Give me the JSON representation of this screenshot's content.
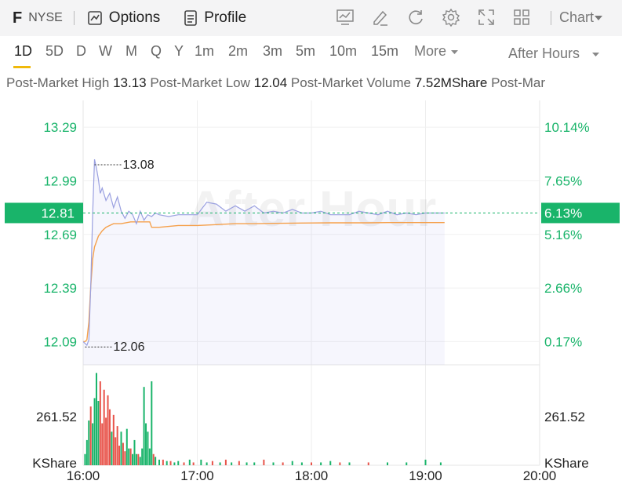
{
  "header": {
    "ticker": "F",
    "exchange": "NYSE",
    "options_label": "Options",
    "profile_label": "Profile",
    "chart_label": "Chart",
    "tools": [
      "analysis-chart-icon",
      "draw-pen-icon",
      "refresh-icon",
      "settings-icon",
      "fullscreen-icon",
      "layout-grid-icon"
    ]
  },
  "periods": [
    "1D",
    "5D",
    "D",
    "W",
    "M",
    "Q",
    "Y",
    "1m",
    "2m",
    "3m",
    "5m",
    "10m",
    "15m"
  ],
  "active_period": "1D",
  "more_label": "More",
  "session_label": "After Hours",
  "stats": [
    {
      "label": "Post-Market High",
      "value": "13.13"
    },
    {
      "label": "Post-Market Low",
      "value": "12.04"
    },
    {
      "label": "Post-Market Volume",
      "value": "7.52MShare"
    },
    {
      "label": "Post-Mar",
      "value": ""
    }
  ],
  "colors": {
    "up": "#19b46a",
    "down": "#e8534a",
    "price_line": "#9aa0e0",
    "avg_line": "#f5a04b",
    "current_tag": "#19b46a",
    "dashed": "#19b46a"
  },
  "chart_data": {
    "type": "line",
    "watermark": "After Hour",
    "y_ticks": [
      "13.29",
      "12.99",
      "12.69",
      "12.39",
      "12.09"
    ],
    "pct_ticks": [
      "10.14%",
      "7.65%",
      "5.16%",
      "2.66%",
      "0.17%"
    ],
    "current_price": "12.81",
    "current_pct": "6.13%",
    "high_annotation": "13.08",
    "low_annotation": "12.06",
    "x_ticks": [
      "16:00",
      "17:00",
      "18:00",
      "19:00",
      "20:00"
    ],
    "volume_tick": "261.52",
    "volume_unit": "KShare",
    "ylim": [
      11.96,
      13.44
    ],
    "x_range_minutes": [
      0,
      240
    ],
    "series": [
      {
        "x": [
          0,
          1,
          2,
          3,
          4,
          5,
          6,
          7,
          8,
          9,
          10,
          12,
          14,
          16,
          18,
          20,
          22,
          24,
          26,
          28,
          30,
          32,
          34,
          36,
          38,
          40,
          45,
          50,
          55,
          60,
          65,
          70,
          75,
          80,
          85,
          90,
          95,
          100,
          105,
          110,
          115,
          120,
          125,
          130,
          135,
          140,
          145,
          150,
          155,
          160,
          165,
          170,
          175,
          180,
          185,
          190
        ],
        "y": [
          12.09,
          12.08,
          12.07,
          12.1,
          12.4,
          12.8,
          13.11,
          13.06,
          13.0,
          12.92,
          12.95,
          12.88,
          12.92,
          12.84,
          12.9,
          12.82,
          12.78,
          12.82,
          12.8,
          12.75,
          12.82,
          12.77,
          12.8,
          12.79,
          12.81,
          12.8,
          12.79,
          12.8,
          12.8,
          12.8,
          12.87,
          12.86,
          12.82,
          12.85,
          12.82,
          12.85,
          12.81,
          12.82,
          12.81,
          12.83,
          12.81,
          12.81,
          12.82,
          12.8,
          12.8,
          12.8,
          12.82,
          12.81,
          12.8,
          12.82,
          12.8,
          12.81,
          12.8,
          12.81,
          12.81,
          12.81
        ]
      },
      {
        "x": [
          0,
          1,
          2,
          3,
          4,
          5,
          6,
          7,
          8,
          10,
          12,
          14,
          16,
          20,
          25,
          30,
          35,
          36,
          40,
          50,
          60,
          70,
          80,
          90,
          100,
          110,
          120,
          130,
          140,
          150,
          160,
          170,
          180,
          190
        ],
        "y": [
          12.09,
          12.09,
          12.1,
          12.2,
          12.4,
          12.55,
          12.62,
          12.65,
          12.68,
          12.71,
          12.73,
          12.74,
          12.75,
          12.75,
          12.76,
          12.76,
          12.76,
          12.73,
          12.73,
          12.74,
          12.74,
          12.745,
          12.75,
          12.75,
          12.752,
          12.753,
          12.754,
          12.755,
          12.755,
          12.755,
          12.756,
          12.756,
          12.756,
          12.756
        ]
      }
    ],
    "volume": [
      {
        "x": 1,
        "v": 40,
        "c": "up"
      },
      {
        "x": 2,
        "v": 90,
        "c": "up"
      },
      {
        "x": 3,
        "v": 160,
        "c": "up"
      },
      {
        "x": 4,
        "v": 210,
        "c": "down"
      },
      {
        "x": 5,
        "v": 150,
        "c": "up"
      },
      {
        "x": 6,
        "v": 240,
        "c": "up"
      },
      {
        "x": 7,
        "v": 330,
        "c": "up"
      },
      {
        "x": 8,
        "v": 230,
        "c": "up"
      },
      {
        "x": 9,
        "v": 300,
        "c": "down"
      },
      {
        "x": 10,
        "v": 150,
        "c": "down"
      },
      {
        "x": 11,
        "v": 270,
        "c": "down"
      },
      {
        "x": 12,
        "v": 170,
        "c": "down"
      },
      {
        "x": 13,
        "v": 250,
        "c": "down"
      },
      {
        "x": 14,
        "v": 200,
        "c": "down"
      },
      {
        "x": 15,
        "v": 120,
        "c": "up"
      },
      {
        "x": 16,
        "v": 180,
        "c": "down"
      },
      {
        "x": 17,
        "v": 100,
        "c": "down"
      },
      {
        "x": 18,
        "v": 140,
        "c": "down"
      },
      {
        "x": 19,
        "v": 70,
        "c": "down"
      },
      {
        "x": 20,
        "v": 120,
        "c": "up"
      },
      {
        "x": 21,
        "v": 80,
        "c": "down"
      },
      {
        "x": 22,
        "v": 50,
        "c": "down"
      },
      {
        "x": 23,
        "v": 130,
        "c": "up"
      },
      {
        "x": 24,
        "v": 60,
        "c": "up"
      },
      {
        "x": 25,
        "v": 60,
        "c": "down"
      },
      {
        "x": 26,
        "v": 40,
        "c": "up"
      },
      {
        "x": 27,
        "v": 90,
        "c": "up"
      },
      {
        "x": 28,
        "v": 40,
        "c": "up"
      },
      {
        "x": 29,
        "v": 40,
        "c": "down"
      },
      {
        "x": 30,
        "v": 30,
        "c": "up"
      },
      {
        "x": 31,
        "v": 60,
        "c": "up"
      },
      {
        "x": 32,
        "v": 280,
        "c": "up"
      },
      {
        "x": 33,
        "v": 150,
        "c": "up"
      },
      {
        "x": 34,
        "v": 120,
        "c": "up"
      },
      {
        "x": 35,
        "v": 60,
        "c": "up"
      },
      {
        "x": 36,
        "v": 300,
        "c": "up"
      },
      {
        "x": 37,
        "v": 40,
        "c": "down"
      },
      {
        "x": 38,
        "v": 30,
        "c": "up"
      },
      {
        "x": 40,
        "v": 20,
        "c": "up"
      },
      {
        "x": 42,
        "v": 20,
        "c": "down"
      },
      {
        "x": 44,
        "v": 15,
        "c": "up"
      },
      {
        "x": 46,
        "v": 15,
        "c": "down"
      },
      {
        "x": 48,
        "v": 10,
        "c": "up"
      },
      {
        "x": 50,
        "v": 15,
        "c": "up"
      },
      {
        "x": 53,
        "v": 10,
        "c": "down"
      },
      {
        "x": 56,
        "v": 20,
        "c": "up"
      },
      {
        "x": 58,
        "v": 10,
        "c": "down"
      },
      {
        "x": 62,
        "v": 20,
        "c": "up"
      },
      {
        "x": 65,
        "v": 10,
        "c": "up"
      },
      {
        "x": 68,
        "v": 15,
        "c": "down"
      },
      {
        "x": 72,
        "v": 10,
        "c": "up"
      },
      {
        "x": 75,
        "v": 20,
        "c": "down"
      },
      {
        "x": 78,
        "v": 10,
        "c": "up"
      },
      {
        "x": 82,
        "v": 15,
        "c": "down"
      },
      {
        "x": 86,
        "v": 10,
        "c": "up"
      },
      {
        "x": 90,
        "v": 10,
        "c": "up"
      },
      {
        "x": 95,
        "v": 20,
        "c": "down"
      },
      {
        "x": 100,
        "v": 10,
        "c": "up"
      },
      {
        "x": 105,
        "v": 10,
        "c": "down"
      },
      {
        "x": 110,
        "v": 15,
        "c": "up"
      },
      {
        "x": 115,
        "v": 10,
        "c": "up"
      },
      {
        "x": 120,
        "v": 10,
        "c": "down"
      },
      {
        "x": 125,
        "v": 10,
        "c": "up"
      },
      {
        "x": 130,
        "v": 15,
        "c": "up"
      },
      {
        "x": 135,
        "v": 10,
        "c": "down"
      },
      {
        "x": 140,
        "v": 10,
        "c": "up"
      },
      {
        "x": 150,
        "v": 10,
        "c": "down"
      },
      {
        "x": 160,
        "v": 10,
        "c": "up"
      },
      {
        "x": 170,
        "v": 10,
        "c": "up"
      },
      {
        "x": 180,
        "v": 20,
        "c": "up"
      },
      {
        "x": 188,
        "v": 10,
        "c": "up"
      }
    ],
    "volume_max": 345
  }
}
